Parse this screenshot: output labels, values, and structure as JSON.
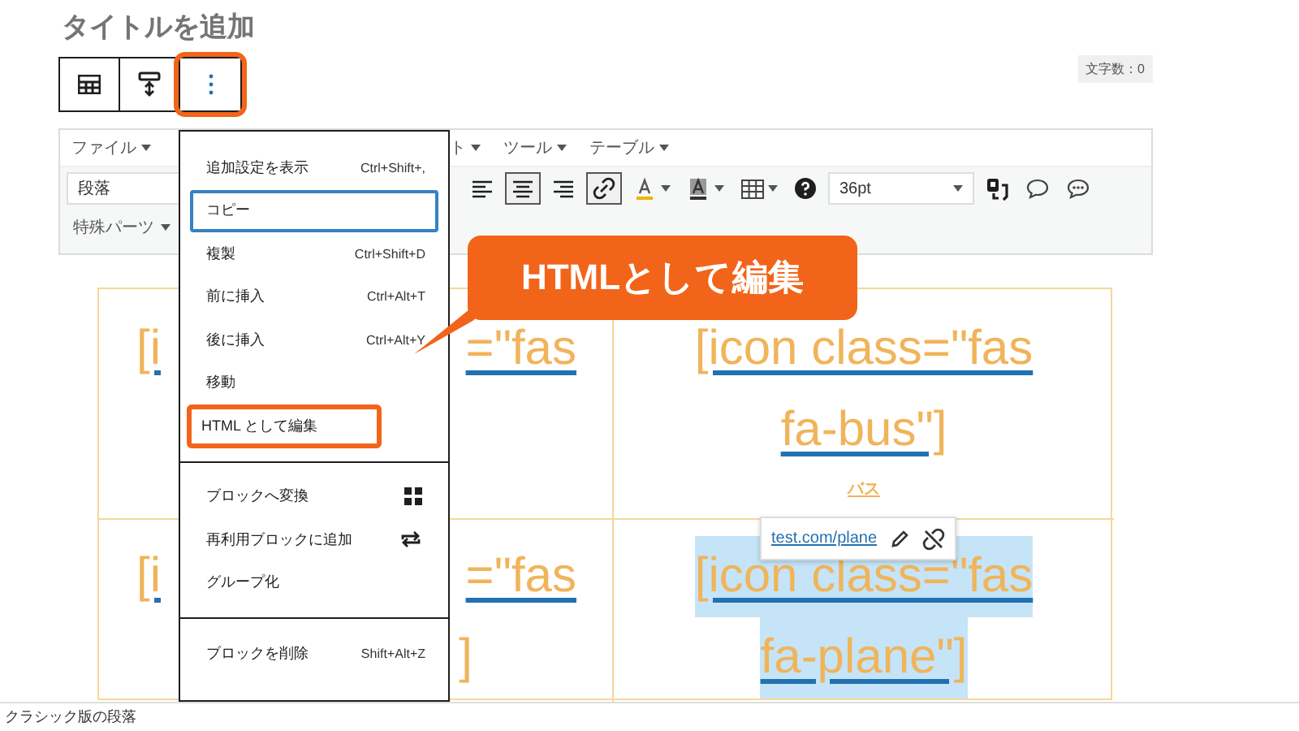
{
  "title": "タイトルを追加",
  "block_toolbar": [
    {
      "kind": "table",
      "annotated": false
    },
    {
      "kind": "align",
      "annotated": false
    },
    {
      "kind": "more",
      "annotated": true
    }
  ],
  "word_count": "文字数：0",
  "classic_editor": {
    "menubar": [
      {
        "label": "ファイル"
      },
      {
        "label": "ト"
      },
      {
        "label": "ツール"
      },
      {
        "label": "テーブル"
      }
    ],
    "format_select": "段落",
    "tools": [
      {
        "kind": "align-left",
        "pressed": false
      },
      {
        "kind": "align-center",
        "pressed": true
      },
      {
        "kind": "align-right",
        "pressed": false
      },
      {
        "kind": "link",
        "pressed": true
      },
      {
        "kind": "text-color",
        "pressed": false
      },
      {
        "kind": "bg-color",
        "pressed": false
      },
      {
        "kind": "table",
        "pressed": false
      },
      {
        "kind": "help",
        "pressed": false
      }
    ],
    "font_size": "36pt",
    "extra_tools": [
      {
        "kind": "shortcode"
      },
      {
        "kind": "bubble"
      },
      {
        "kind": "bubble-dots"
      }
    ],
    "special_parts": "特殊パーツ"
  },
  "table": {
    "rows": [
      [
        {
          "kind": "covered",
          "lines": [
            [
              "[i",
              "=\"fas"
            ]
          ],
          "selected": false
        },
        {
          "kind": "full",
          "lines": [
            [
              "[icon class=\"fas"
            ],
            [
              "fa-bus\"]"
            ]
          ],
          "caption": "バス",
          "selected": false
        }
      ],
      [
        {
          "kind": "covered",
          "lines": [
            [
              "[i",
              "=\"fas"
            ],
            [
              "]"
            ]
          ],
          "selected": false
        },
        {
          "kind": "full",
          "lines": [
            [
              "[icon class=\"fas"
            ],
            [
              "fa-plane\"]"
            ]
          ],
          "selected": true
        }
      ]
    ]
  },
  "link_popup": {
    "url": "test.com/plane"
  },
  "menu": {
    "groups": [
      [
        {
          "label": "追加設定を表示",
          "kind": "shortcut",
          "shortcut": "Ctrl+Shift+,",
          "focused": false,
          "annotated": false
        },
        {
          "label": "コピー",
          "kind": "plain",
          "focused": true,
          "annotated": false
        },
        {
          "label": "複製",
          "kind": "shortcut",
          "shortcut": "Ctrl+Shift+D",
          "focused": false,
          "annotated": false
        },
        {
          "label": "前に挿入",
          "kind": "shortcut",
          "shortcut": "Ctrl+Alt+T",
          "focused": false,
          "annotated": false
        },
        {
          "label": "後に挿入",
          "kind": "shortcut",
          "shortcut": "Ctrl+Alt+Y",
          "focused": false,
          "annotated": false
        },
        {
          "label": "移動",
          "kind": "plain",
          "focused": false,
          "annotated": false
        },
        {
          "label": "HTML として編集",
          "kind": "plain",
          "focused": false,
          "annotated": true
        }
      ],
      [
        {
          "label": "ブロックへ変換",
          "kind": "grid",
          "focused": false,
          "annotated": false
        },
        {
          "label": "再利用ブロックに追加",
          "kind": "repeat",
          "focused": false,
          "annotated": false
        },
        {
          "label": "グループ化",
          "kind": "plain",
          "focused": false,
          "annotated": false
        }
      ],
      [
        {
          "label": "ブロックを削除",
          "kind": "shortcut",
          "shortcut": "Shift+Alt+Z",
          "focused": false,
          "annotated": false
        }
      ]
    ]
  },
  "callout": {
    "text": "HTMLとして編集"
  },
  "status_bar": "クラシック版の段落"
}
